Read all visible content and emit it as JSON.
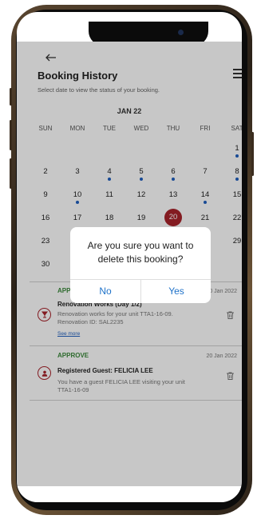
{
  "header": {
    "back_icon": "arrow-left-icon",
    "title": "Booking History",
    "subtitle": "Select date to view the status of your booking.",
    "menu_icon": "list-menu-icon"
  },
  "calendar": {
    "month_label": "JAN 22",
    "weekdays": [
      "SUN",
      "MON",
      "TUE",
      "WED",
      "THU",
      "FRI",
      "SAT"
    ],
    "weeks": [
      [
        "",
        "",
        "",
        "",
        "",
        "",
        "1"
      ],
      [
        "2",
        "3",
        "4",
        "5",
        "6",
        "7",
        "8"
      ],
      [
        "9",
        "10",
        "11",
        "12",
        "13",
        "14",
        "15"
      ],
      [
        "16",
        "17",
        "18",
        "19",
        "20",
        "21",
        "22"
      ],
      [
        "23",
        "",
        "",
        "",
        "",
        "",
        "29"
      ],
      [
        "30",
        "",
        "",
        "",
        "",
        "",
        ""
      ]
    ],
    "selected_day": "20",
    "marked_days": [
      "1",
      "4",
      "5",
      "6",
      "8",
      "10",
      "14"
    ],
    "colors": {
      "selected": "#a8232b",
      "dot": "#1f5fbf"
    }
  },
  "bookings": [
    {
      "status": "APPR",
      "date": "20 Jan 2022",
      "icon": "wine-glass-icon",
      "title": "Renovation Works (Day 1/2)",
      "desc_line1": "Renovation works for your unit TTA1-16-09.",
      "desc_line2": "Renovation ID: SAL2235",
      "see_more": "See more"
    },
    {
      "status": "APPROVE",
      "date": "20 Jan 2022",
      "icon": "person-icon",
      "title": "Registered Guest: FELICIA LEE",
      "desc_line1": "You have a guest FELICIA LEE visiting your unit",
      "desc_line2": "TTA1-16-09"
    }
  ],
  "dialog": {
    "message_line1": "Are you sure you want to",
    "message_line2": "delete this booking?",
    "no_label": "No",
    "yes_label": "Yes",
    "accent": "#1f72c9"
  },
  "status_color": "#3b8a3b"
}
